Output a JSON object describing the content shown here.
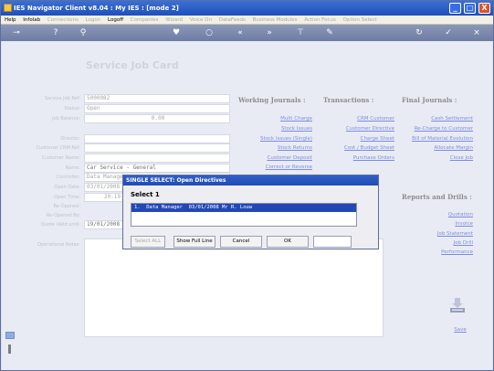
{
  "window": {
    "title": "IES Navigator Client v8.04 : My IES :       [mode 2]",
    "minimize": "_",
    "maximize": "□",
    "close": "X"
  },
  "menu": {
    "items": [
      "Help",
      "Infolab",
      "Connections",
      "Logon",
      "Logoff",
      "Companies",
      "Wizard",
      "Voice On",
      "DataFeeds",
      "Business Modules",
      "Action Focus",
      "Option Select"
    ],
    "enabled": [
      true,
      true,
      false,
      false,
      true,
      false,
      false,
      false,
      false,
      false,
      false,
      false
    ]
  },
  "toolbar": {
    "icons": [
      "key-icon",
      "help-icon",
      "search-icon",
      "heart-icon",
      "lock-icon",
      "rewind-icon",
      "forward-icon",
      "first-icon",
      "pen-icon",
      "refresh-icon",
      "check-icon",
      "close-icon"
    ]
  },
  "page": {
    "title": "Service Job Card"
  },
  "fields": [
    {
      "label": "Service Job Ref:",
      "value": "5000082"
    },
    {
      "label": "Status:",
      "value": "Open"
    },
    {
      "label": "Job Balance:",
      "value": "0.00"
    },
    {
      "label": "Director:",
      "value": ""
    },
    {
      "label": "Customer CRM Ref:",
      "value": ""
    },
    {
      "label": "Customer Name:",
      "value": ""
    },
    {
      "label": "Name:",
      "value": "Car Service - General"
    },
    {
      "label": "Controller:",
      "value": "Data Manager"
    },
    {
      "label": "Open Date:",
      "value": "03/01/2008"
    },
    {
      "label": "Open Time:",
      "value": "20:19"
    },
    {
      "label": "Re-Opened:",
      "value": ""
    },
    {
      "label": "Re-Opened By:",
      "value": ""
    },
    {
      "label": "Quote Valid until:",
      "value": "19/01/2008"
    },
    {
      "label": "Operational Notes:",
      "value": ""
    }
  ],
  "columns": {
    "working": {
      "heading": "Working Journals :",
      "links": [
        "Multi Charge",
        "Stock Issues",
        "Stock Issues (Single)",
        "Stock Returns",
        "Customer Deposit",
        "Correct or Reverse"
      ]
    },
    "transactions": {
      "heading": "Transactions :",
      "links": [
        "CRM Customer",
        "Customer Directive",
        "Charge Sheet",
        "Cost / Budget Sheet",
        "Purchase Orders"
      ]
    },
    "final": {
      "heading": "Final Journals :",
      "links": [
        "Cash Settlement",
        "Re-Charge to Customer",
        "Bill of Material Evolution",
        "Allocate Margin",
        "Close Job"
      ]
    },
    "reports": {
      "heading": "Reports and Drills :",
      "links": [
        "Quotation",
        "Invoice",
        "Job Statement",
        "Job Drill",
        "Performance"
      ]
    }
  },
  "save_label": "Save",
  "dialog": {
    "title": "SINGLE SELECT: Open Directives",
    "subtitle": "Select 1",
    "rows": [
      "1.  Data Manager  03/01/2008 Mr R. Louw"
    ],
    "buttons": {
      "select_all": "Select ALL",
      "show_full_line": "Show Full Line",
      "cancel": "Cancel",
      "ok": "OK"
    },
    "count_value": ""
  }
}
